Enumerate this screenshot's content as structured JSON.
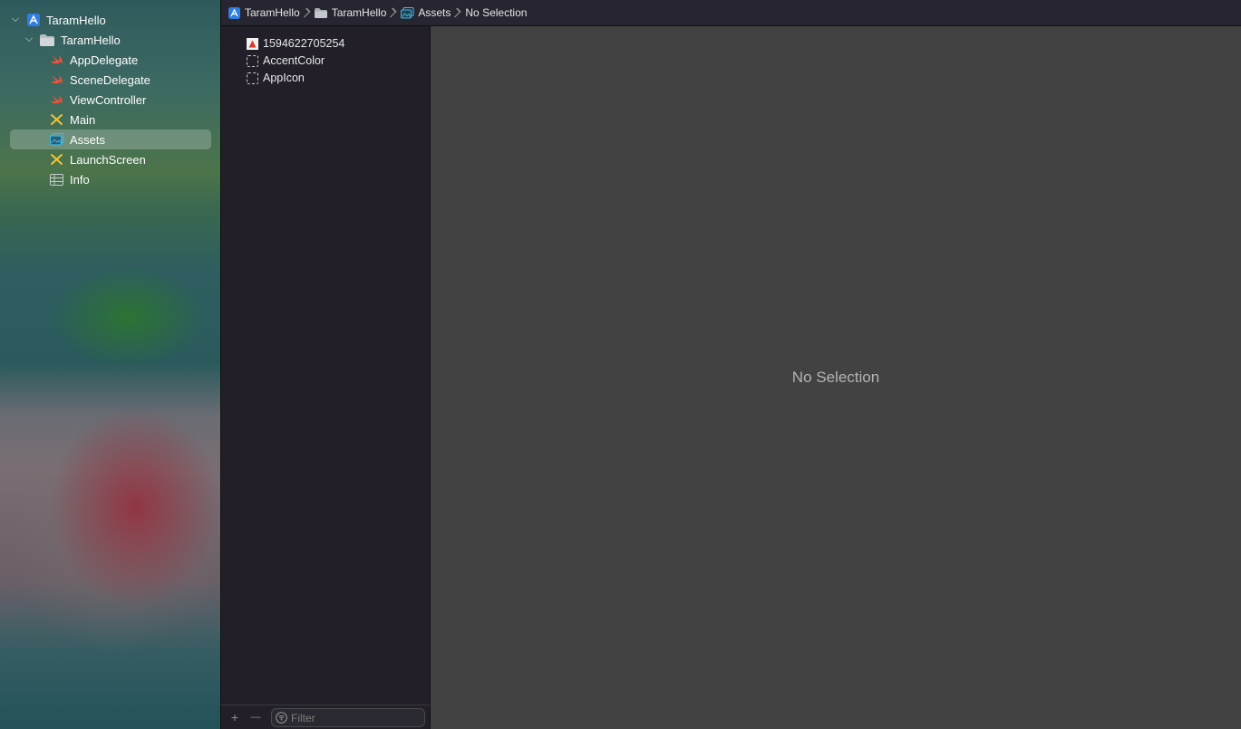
{
  "navigator": {
    "project": {
      "label": "TaramHello",
      "icon": "xcode-project-icon"
    },
    "group": {
      "label": "TaramHello",
      "icon": "folder-icon"
    },
    "files": [
      {
        "label": "AppDelegate",
        "icon": "swift-file-icon"
      },
      {
        "label": "SceneDelegate",
        "icon": "swift-file-icon"
      },
      {
        "label": "ViewController",
        "icon": "swift-file-icon"
      },
      {
        "label": "Main",
        "icon": "storyboard-icon"
      },
      {
        "label": "Assets",
        "icon": "asset-catalog-icon",
        "selected": true
      },
      {
        "label": "LaunchScreen",
        "icon": "storyboard-icon"
      },
      {
        "label": "Info",
        "icon": "plist-table-icon"
      }
    ]
  },
  "jumpbar": {
    "crumbs": [
      {
        "label": "TaramHello",
        "icon": "xcode-project-icon"
      },
      {
        "label": "TaramHello",
        "icon": "folder-icon"
      },
      {
        "label": "Assets",
        "icon": "asset-catalog-icon"
      },
      {
        "label": "No Selection",
        "icon": ""
      }
    ]
  },
  "assets": {
    "items": [
      {
        "label": "1594622705254",
        "icon": "image-set-icon"
      },
      {
        "label": "AccentColor",
        "icon": "color-set-icon"
      },
      {
        "label": "AppIcon",
        "icon": "app-icon-set-icon"
      }
    ],
    "footer": {
      "add_label": "+",
      "remove_label": "—",
      "filter_placeholder": "Filter"
    }
  },
  "editor": {
    "empty_message": "No Selection"
  },
  "colors": {
    "swift": "#f05138",
    "storyboard": "#f4c430",
    "project": "#2f7de1",
    "asset": "#3fb8e8"
  }
}
